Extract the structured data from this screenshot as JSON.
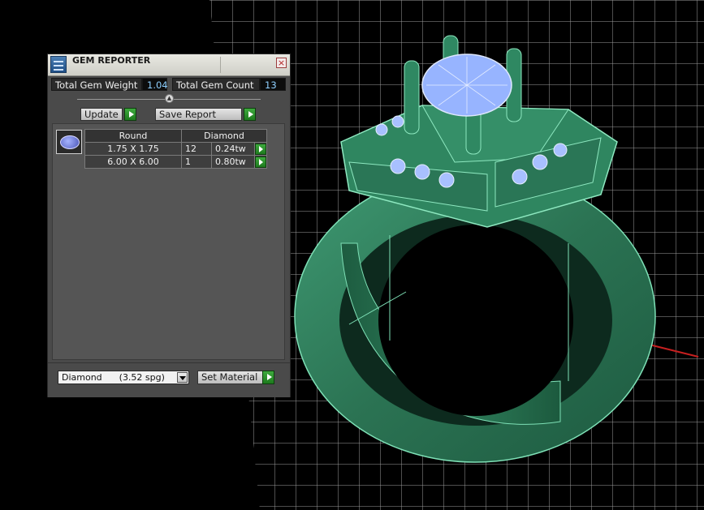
{
  "window": {
    "title": "GEM REPORTER",
    "close_icon": "close-icon",
    "app_icon": "gem-reporter-icon"
  },
  "stats": {
    "weight_label": "Total Gem Weight",
    "weight_value": "1.04",
    "count_label": "Total Gem Count",
    "count_value": "13"
  },
  "toolbar": {
    "update_label": "Update",
    "save_label": "Save Report"
  },
  "gem_table": {
    "shape": "Round",
    "material": "Diamond",
    "rows": [
      {
        "size": "1.75 X 1.75",
        "count": "12",
        "weight": "0.24tw"
      },
      {
        "size": "6.00 X 6.00",
        "count": "1",
        "weight": "0.80tw"
      }
    ]
  },
  "material_select": {
    "value": "Diamond      (3.52 spg)",
    "set_label": "Set Material"
  },
  "colors": {
    "ring": "#2e7a58",
    "gem": "#9fb8ff",
    "grid": "#bfbfbf",
    "accent_go": "#2e8f2e"
  }
}
